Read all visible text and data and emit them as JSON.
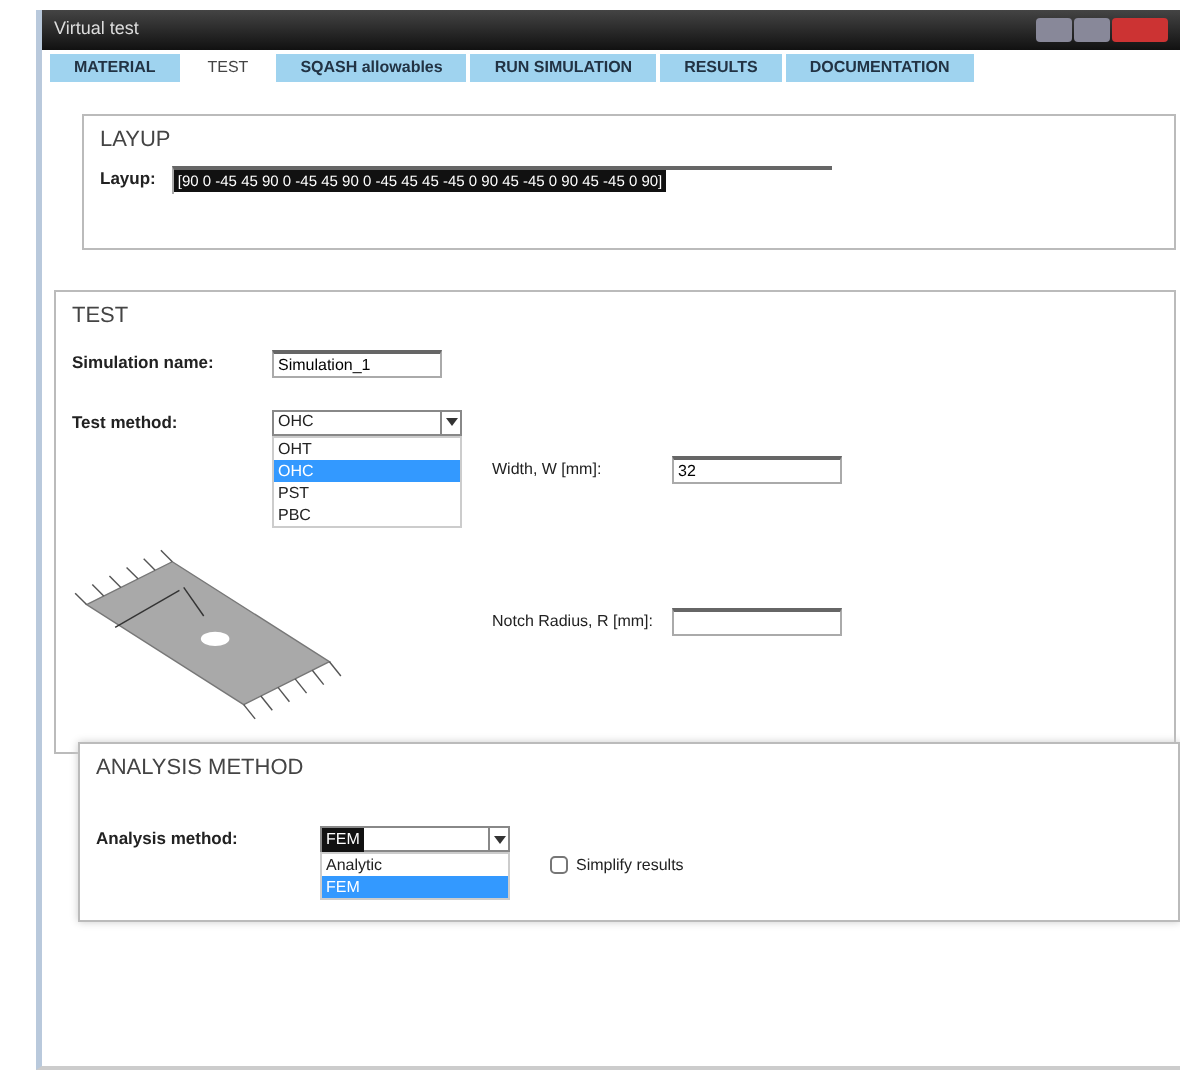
{
  "window": {
    "title": "Virtual test"
  },
  "tabs": [
    {
      "label": "MATERIAL",
      "selected": false
    },
    {
      "label": "TEST",
      "selected": true
    },
    {
      "label": "SQASH allowables",
      "selected": false
    },
    {
      "label": "RUN SIMULATION",
      "selected": false
    },
    {
      "label": "RESULTS",
      "selected": false
    },
    {
      "label": "DOCUMENTATION",
      "selected": false
    }
  ],
  "layup": {
    "title": "LAYUP",
    "label": "Layup:",
    "value": "[90 0 -45 45 90 0 -45 45 90 0 -45 45 45 -45 0 90 45 -45 0 90 45 -45 0 90]"
  },
  "test": {
    "title": "TEST",
    "simulation_name": {
      "label": "Simulation name:",
      "value": "Simulation_1"
    },
    "test_method": {
      "label": "Test method:",
      "value": "OHC",
      "options": [
        {
          "label": "OHT",
          "selected": false
        },
        {
          "label": "OHC",
          "selected": true
        },
        {
          "label": "PST",
          "selected": false
        },
        {
          "label": "PBC",
          "selected": false
        }
      ]
    },
    "width": {
      "label": "Width, W [mm]:",
      "value": "32"
    },
    "notch_radius": {
      "label": "Notch Radius, R [mm]:"
    }
  },
  "analysis": {
    "title": "ANALYSIS METHOD",
    "analysis_method": {
      "label": "Analysis method:",
      "value": "FEM",
      "options": [
        {
          "label": "Analytic",
          "selected": false
        },
        {
          "label": "FEM",
          "selected": true
        }
      ]
    },
    "simplify": {
      "label": "Simplify results",
      "checked": false
    }
  }
}
